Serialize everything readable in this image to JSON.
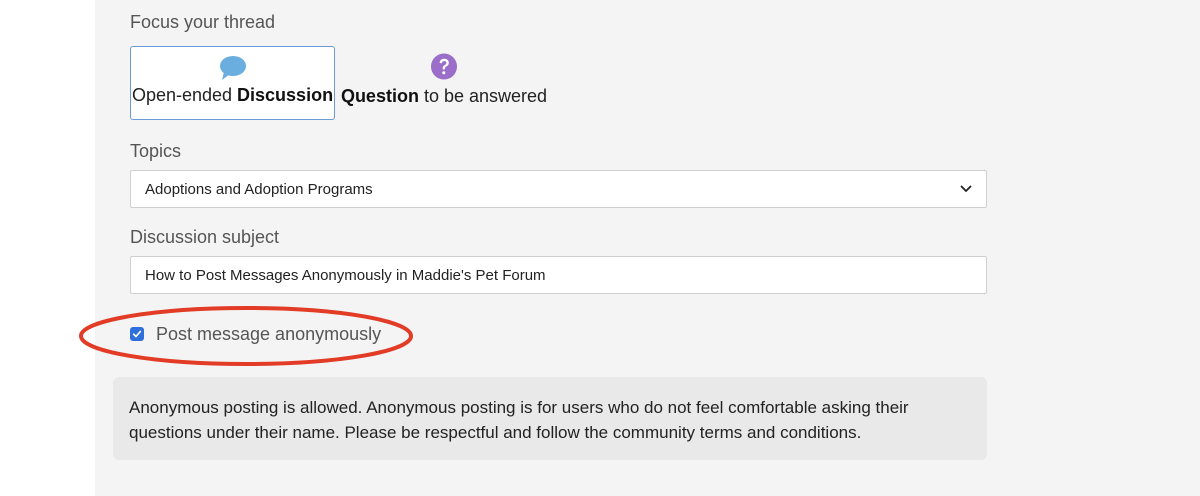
{
  "focus": {
    "label": "Focus your thread",
    "options": [
      {
        "pre": "Open-ended ",
        "bold": "Discussion",
        "post": "",
        "icon": "speech-bubble-icon",
        "icon_color": "#6aaee0",
        "selected": true
      },
      {
        "pre": "",
        "bold": "Question",
        "post": " to be answered",
        "icon": "question-mark-icon",
        "icon_color": "#9b6fc9",
        "selected": false
      }
    ]
  },
  "topics": {
    "label": "Topics",
    "selected": "Adoptions and Adoption Programs"
  },
  "subject": {
    "label": "Discussion subject",
    "value": "How to Post Messages Anonymously in Maddie's Pet Forum"
  },
  "anonymous": {
    "label": "Post message anonymously",
    "checked": true,
    "checkbox_color": "#2f6fdc",
    "highlight_color": "#e23b26"
  },
  "notice": {
    "line1": "Anonymous posting is allowed. Anonymous posting is for users who do not feel comfortable asking their",
    "line2": "questions under their name. Please be respectful and follow the community terms and conditions."
  }
}
